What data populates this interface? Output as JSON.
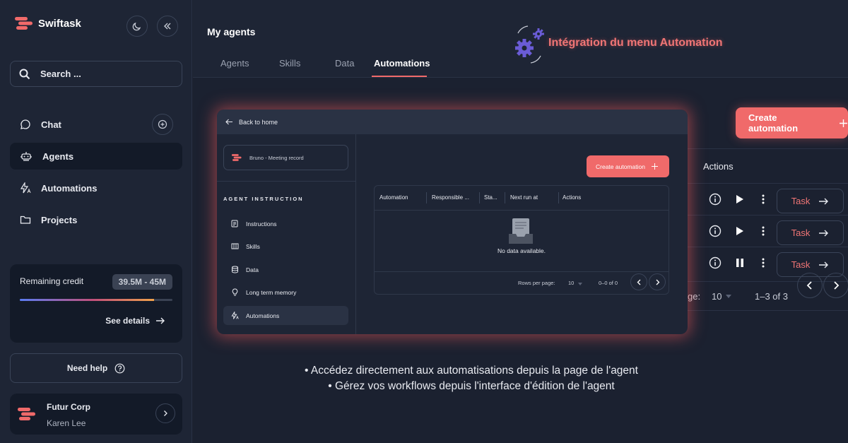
{
  "app": {
    "name": "Swiftask",
    "brand_color": "#f06a6a"
  },
  "sidebar": {
    "search_placeholder": "Search ...",
    "nav": [
      {
        "label": "Chat",
        "icon": "chat-bubble-icon"
      },
      {
        "label": "Agents",
        "icon": "robot-icon"
      },
      {
        "label": "Automations",
        "icon": "automation-icon"
      },
      {
        "label": "Projects",
        "icon": "folder-icon"
      }
    ],
    "active_item": "Agents",
    "credit": {
      "label": "Remaining credit",
      "value": "39.5M - 45M",
      "fill_fraction": 0.88,
      "details_label": "See details"
    },
    "help_label": "Need help",
    "org": {
      "name": "Futur Corp",
      "user": "Karen Lee"
    }
  },
  "header": {
    "title": "My agents",
    "tabs": [
      "Agents",
      "Skills",
      "Data",
      "Automations"
    ],
    "active_tab": "Automations"
  },
  "promo": {
    "title": "Intégration du menu Automation",
    "bullets": [
      "• Accédez directement aux automatisations depuis la page de l'agent",
      "• Gérez vos workflows depuis l'interface d'édition de l'agent"
    ]
  },
  "main": {
    "create_label": "Create automation",
    "actions_header": "Actions",
    "rows": [
      {
        "state": "play",
        "task_label": "Task"
      },
      {
        "state": "play",
        "task_label": "Task"
      },
      {
        "state": "pause",
        "task_label": "Task"
      }
    ],
    "rows_per_page_label": "ge:",
    "rows_per_page_value": "10",
    "range": "1–3 of 3"
  },
  "inset": {
    "back_label": "Back to home",
    "agent_name": "Bruno - Meeting record",
    "section_title": "AGENT INSTRUCTION",
    "nav": [
      "Instructions",
      "Skills",
      "Data",
      "Long term memory",
      "Automations"
    ],
    "active_nav": "Automations",
    "create_label": "Create automation",
    "columns": [
      "Automation",
      "Responsible ...",
      "Sta...",
      "Next run at",
      "Actions"
    ],
    "empty_text": "No data available.",
    "rows_per_page_label": "Rows per page:",
    "rows_per_page_value": "10",
    "range": "0–0 of 0"
  }
}
